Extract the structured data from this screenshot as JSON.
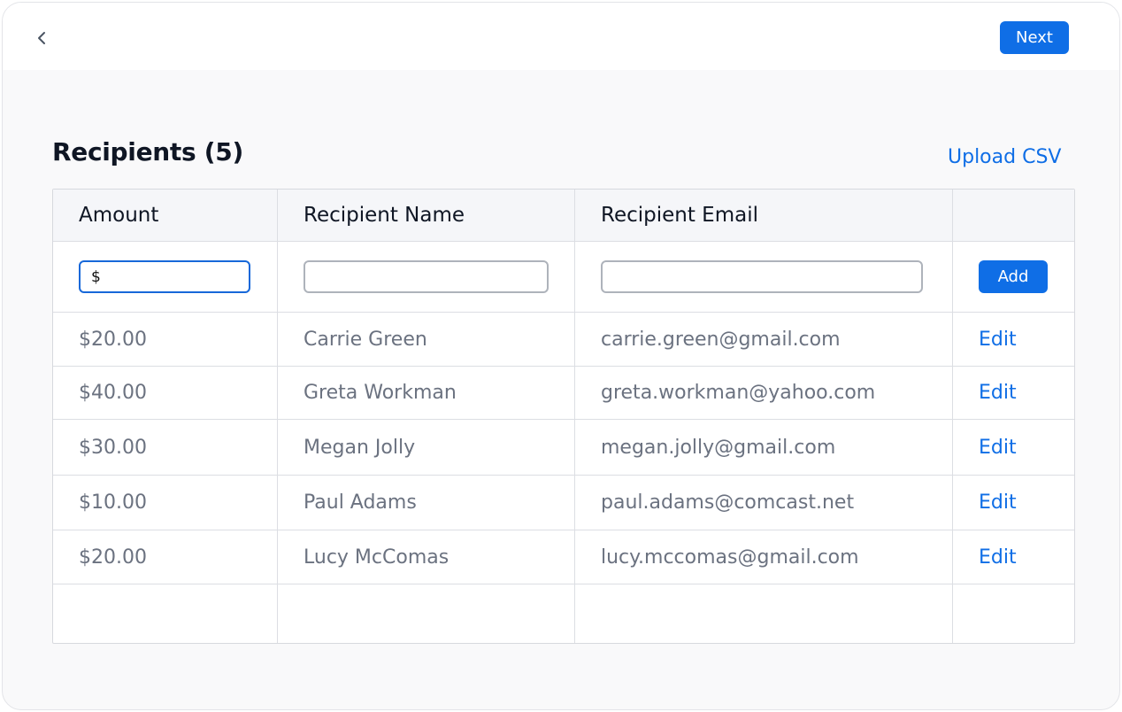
{
  "toolbar": {
    "next_label": "Next"
  },
  "section": {
    "title": "Recipients (5)",
    "upload_label": "Upload CSV"
  },
  "table": {
    "headers": [
      "Amount",
      "Recipient Name",
      "Recipient Email",
      ""
    ],
    "new_row": {
      "amount_value": "$",
      "name_value": "",
      "email_value": "",
      "add_label": "Add"
    },
    "rows": [
      {
        "amount": "$20.00",
        "name": "Carrie Green",
        "email": "carrie.green@gmail.com",
        "action": "Edit"
      },
      {
        "amount": "$40.00",
        "name": "Greta Workman",
        "email": "greta.workman@yahoo.com",
        "action": "Edit"
      },
      {
        "amount": "$30.00",
        "name": "Megan Jolly",
        "email": "megan.jolly@gmail.com",
        "action": "Edit"
      },
      {
        "amount": "$10.00",
        "name": "Paul Adams",
        "email": "paul.adams@comcast.net",
        "action": "Edit"
      },
      {
        "amount": "$20.00",
        "name": "Lucy McComas",
        "email": "lucy.mccomas@gmail.com",
        "action": "Edit"
      }
    ]
  },
  "colors": {
    "accent": "#0f6ee6",
    "text_primary": "#0f1624",
    "text_muted": "#6b7280",
    "border": "#dcdee3",
    "header_bg": "#f5f6f9"
  },
  "icons": {
    "back": "chevron-left-icon"
  }
}
